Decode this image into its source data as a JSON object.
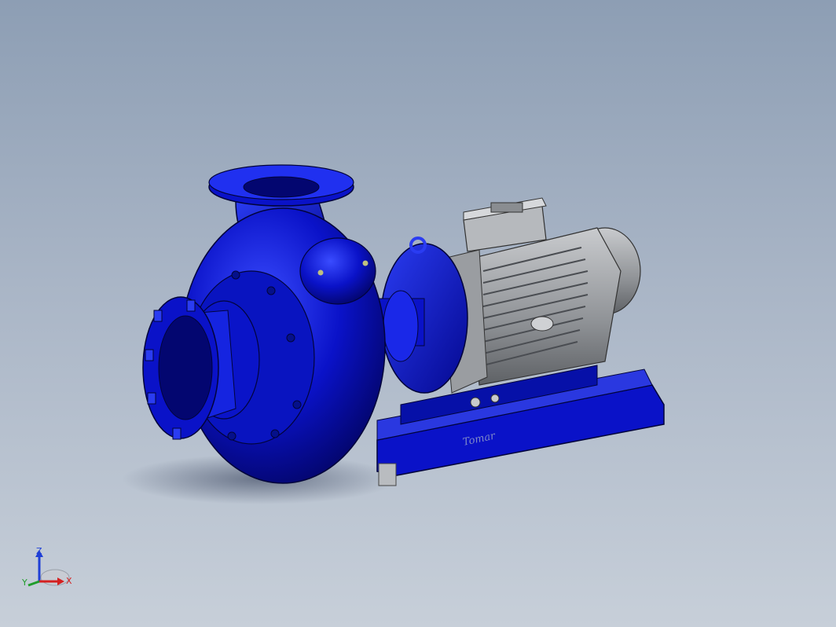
{
  "viewport": {
    "background_top": "#8d9eb4",
    "background_bottom": "#c7cfd9"
  },
  "model": {
    "body_color": "#0a12c8",
    "motor_color": "#8f9296",
    "base_label": "Tomar"
  },
  "triad": {
    "x_label": "X",
    "y_label": "Y",
    "z_label": "Z",
    "x_color": "#d42020",
    "y_color": "#1f9d2a",
    "z_color": "#1f3fd6"
  }
}
